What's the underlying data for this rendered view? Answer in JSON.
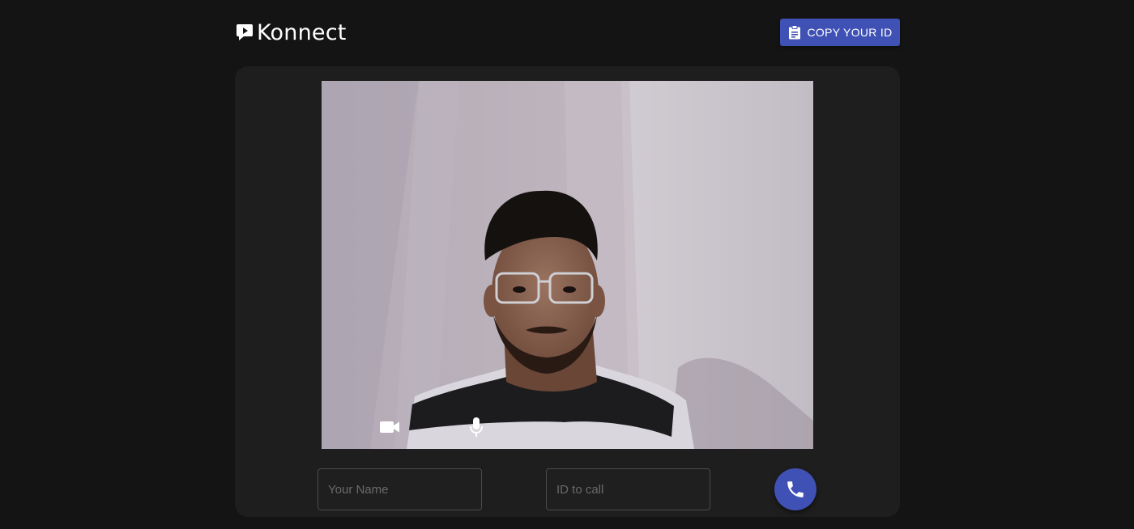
{
  "header": {
    "logo_text": "Konnect",
    "copy_id_label": "COPY YOUR ID"
  },
  "video": {
    "controls": [
      {
        "name": "video-toggle",
        "icon": "videocam-icon"
      },
      {
        "name": "mic-toggle",
        "icon": "mic-icon"
      }
    ]
  },
  "form": {
    "name_placeholder": "Your Name",
    "name_value": "",
    "id_placeholder": "ID to call",
    "id_value": ""
  },
  "colors": {
    "background": "#141414",
    "panel": "#1e1e1e",
    "accent": "#3f51b5"
  }
}
